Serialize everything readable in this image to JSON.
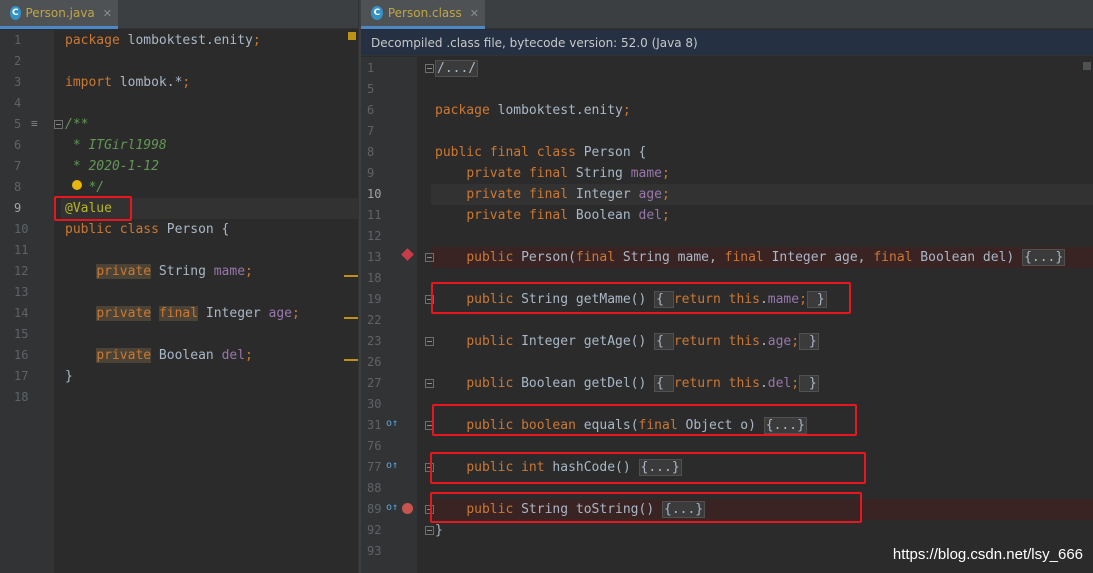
{
  "left": {
    "tab_label": "Person.java",
    "tab_icon": "C",
    "lines": [
      {
        "n": "1",
        "parts": [
          {
            "t": "package",
            "c": "kw"
          },
          {
            "t": " lomboktest.enity",
            "c": ""
          },
          {
            "t": ";",
            "c": "kw"
          }
        ]
      },
      {
        "n": "2",
        "parts": []
      },
      {
        "n": "3",
        "parts": [
          {
            "t": "import",
            "c": "kw"
          },
          {
            "t": " lombok.*",
            "c": ""
          },
          {
            "t": ";",
            "c": "kw"
          }
        ]
      },
      {
        "n": "4",
        "parts": []
      },
      {
        "n": "5",
        "parts": [
          {
            "t": "/**",
            "c": "cmt"
          }
        ]
      },
      {
        "n": "6",
        "parts": [
          {
            "t": " * ITGirl1998",
            "c": "cmt"
          }
        ]
      },
      {
        "n": "7",
        "parts": [
          {
            "t": " * 2020-1-12",
            "c": "cmt"
          }
        ]
      },
      {
        "n": "8",
        "parts": [
          {
            "t": "   */",
            "c": "cmt"
          }
        ]
      },
      {
        "n": "9",
        "parts": [
          {
            "t": "@Value",
            "c": "ann"
          }
        ]
      },
      {
        "n": "10",
        "parts": [
          {
            "t": "public",
            "c": "kw"
          },
          {
            "t": " ",
            "c": ""
          },
          {
            "t": "class",
            "c": "kw"
          },
          {
            "t": " Person {",
            "c": ""
          }
        ]
      },
      {
        "n": "11",
        "parts": []
      },
      {
        "n": "12",
        "parts": [
          {
            "t": "    ",
            "c": ""
          },
          {
            "t": "private",
            "c": "kw hlword"
          },
          {
            "t": " String ",
            "c": ""
          },
          {
            "t": "mame",
            "c": "fld"
          },
          {
            "t": ";",
            "c": "kw"
          }
        ]
      },
      {
        "n": "13",
        "parts": []
      },
      {
        "n": "14",
        "parts": [
          {
            "t": "    ",
            "c": ""
          },
          {
            "t": "private",
            "c": "kw hlword"
          },
          {
            "t": " ",
            "c": ""
          },
          {
            "t": "final",
            "c": "kw hlword"
          },
          {
            "t": " Integer ",
            "c": ""
          },
          {
            "t": "age",
            "c": "fld"
          },
          {
            "t": ";",
            "c": "kw"
          }
        ]
      },
      {
        "n": "15",
        "parts": []
      },
      {
        "n": "16",
        "parts": [
          {
            "t": "    ",
            "c": ""
          },
          {
            "t": "private",
            "c": "kw hlword"
          },
          {
            "t": " Boolean ",
            "c": ""
          },
          {
            "t": "del",
            "c": "fld"
          },
          {
            "t": ";",
            "c": "kw"
          }
        ]
      },
      {
        "n": "17",
        "parts": [
          {
            "t": "}",
            "c": ""
          }
        ]
      },
      {
        "n": "18",
        "parts": []
      }
    ]
  },
  "right": {
    "tab_label": "Person.class",
    "tab_icon": "C",
    "banner": "Decompiled .class file, bytecode version: 52.0 (Java 8)",
    "lines": [
      {
        "n": "1",
        "parts": [
          {
            "t": "/.../",
            "c": "fold"
          }
        ]
      },
      {
        "n": "5",
        "parts": []
      },
      {
        "n": "6",
        "parts": [
          {
            "t": "package",
            "c": "kw"
          },
          {
            "t": " lomboktest.enity",
            "c": ""
          },
          {
            "t": ";",
            "c": "kw"
          }
        ]
      },
      {
        "n": "7",
        "parts": []
      },
      {
        "n": "8",
        "parts": [
          {
            "t": "public",
            "c": "kw"
          },
          {
            "t": " ",
            "c": ""
          },
          {
            "t": "final",
            "c": "kw"
          },
          {
            "t": " ",
            "c": ""
          },
          {
            "t": "class",
            "c": "kw"
          },
          {
            "t": " Person {",
            "c": ""
          }
        ]
      },
      {
        "n": "9",
        "parts": [
          {
            "t": "    ",
            "c": ""
          },
          {
            "t": "private",
            "c": "kw"
          },
          {
            "t": " ",
            "c": ""
          },
          {
            "t": "final",
            "c": "kw"
          },
          {
            "t": " String ",
            "c": ""
          },
          {
            "t": "mame",
            "c": "fld"
          },
          {
            "t": ";",
            "c": "kw"
          }
        ]
      },
      {
        "n": "10",
        "parts": [
          {
            "t": "    ",
            "c": ""
          },
          {
            "t": "private",
            "c": "kw"
          },
          {
            "t": " ",
            "c": ""
          },
          {
            "t": "final",
            "c": "kw"
          },
          {
            "t": " Integer ",
            "c": ""
          },
          {
            "t": "age",
            "c": "fld"
          },
          {
            "t": ";",
            "c": "kw"
          }
        ]
      },
      {
        "n": "11",
        "parts": [
          {
            "t": "    ",
            "c": ""
          },
          {
            "t": "private",
            "c": "kw"
          },
          {
            "t": " ",
            "c": ""
          },
          {
            "t": "final",
            "c": "kw"
          },
          {
            "t": " Boolean ",
            "c": ""
          },
          {
            "t": "del",
            "c": "fld"
          },
          {
            "t": ";",
            "c": "kw"
          }
        ]
      },
      {
        "n": "12",
        "parts": []
      },
      {
        "n": "13",
        "parts": [
          {
            "t": "    ",
            "c": ""
          },
          {
            "t": "public",
            "c": "kw"
          },
          {
            "t": " Person(",
            "c": ""
          },
          {
            "t": "final",
            "c": "kw"
          },
          {
            "t": " String mame, ",
            "c": ""
          },
          {
            "t": "final",
            "c": "kw"
          },
          {
            "t": " Integer age, ",
            "c": ""
          },
          {
            "t": "final",
            "c": "kw"
          },
          {
            "t": " Boolean del) ",
            "c": ""
          },
          {
            "t": "{...}",
            "c": "fold"
          }
        ]
      },
      {
        "n": "18",
        "parts": []
      },
      {
        "n": "19",
        "parts": [
          {
            "t": "    ",
            "c": ""
          },
          {
            "t": "public",
            "c": "kw"
          },
          {
            "t": " String getMame() ",
            "c": ""
          },
          {
            "t": "{ ",
            "c": "fold"
          },
          {
            "t": "return",
            "c": "kw"
          },
          {
            "t": " ",
            "c": ""
          },
          {
            "t": "this",
            "c": "kw"
          },
          {
            "t": ".",
            "c": ""
          },
          {
            "t": "mame",
            "c": "fld"
          },
          {
            "t": ";",
            "c": "kw"
          },
          {
            "t": " }",
            "c": "fold"
          }
        ]
      },
      {
        "n": "22",
        "parts": []
      },
      {
        "n": "23",
        "parts": [
          {
            "t": "    ",
            "c": ""
          },
          {
            "t": "public",
            "c": "kw"
          },
          {
            "t": " Integer getAge() ",
            "c": ""
          },
          {
            "t": "{ ",
            "c": "fold"
          },
          {
            "t": "return",
            "c": "kw"
          },
          {
            "t": " ",
            "c": ""
          },
          {
            "t": "this",
            "c": "kw"
          },
          {
            "t": ".",
            "c": ""
          },
          {
            "t": "age",
            "c": "fld"
          },
          {
            "t": ";",
            "c": "kw"
          },
          {
            "t": " }",
            "c": "fold"
          }
        ]
      },
      {
        "n": "26",
        "parts": []
      },
      {
        "n": "27",
        "parts": [
          {
            "t": "    ",
            "c": ""
          },
          {
            "t": "public",
            "c": "kw"
          },
          {
            "t": " Boolean getDel() ",
            "c": ""
          },
          {
            "t": "{ ",
            "c": "fold"
          },
          {
            "t": "return",
            "c": "kw"
          },
          {
            "t": " ",
            "c": ""
          },
          {
            "t": "this",
            "c": "kw"
          },
          {
            "t": ".",
            "c": ""
          },
          {
            "t": "del",
            "c": "fld"
          },
          {
            "t": ";",
            "c": "kw"
          },
          {
            "t": " }",
            "c": "fold"
          }
        ]
      },
      {
        "n": "30",
        "parts": []
      },
      {
        "n": "31",
        "parts": [
          {
            "t": "    ",
            "c": ""
          },
          {
            "t": "public",
            "c": "kw"
          },
          {
            "t": " ",
            "c": ""
          },
          {
            "t": "boolean",
            "c": "kw"
          },
          {
            "t": " equals(",
            "c": ""
          },
          {
            "t": "final",
            "c": "kw"
          },
          {
            "t": " Object o) ",
            "c": ""
          },
          {
            "t": "{...}",
            "c": "fold"
          }
        ]
      },
      {
        "n": "76",
        "parts": []
      },
      {
        "n": "77",
        "parts": [
          {
            "t": "    ",
            "c": ""
          },
          {
            "t": "public",
            "c": "kw"
          },
          {
            "t": " ",
            "c": ""
          },
          {
            "t": "int",
            "c": "kw"
          },
          {
            "t": " hashCode() ",
            "c": ""
          },
          {
            "t": "{...}",
            "c": "fold"
          }
        ]
      },
      {
        "n": "88",
        "parts": []
      },
      {
        "n": "89",
        "parts": [
          {
            "t": "    ",
            "c": ""
          },
          {
            "t": "public",
            "c": "kw"
          },
          {
            "t": " String toString() ",
            "c": ""
          },
          {
            "t": "{...}",
            "c": "fold"
          }
        ]
      },
      {
        "n": "92",
        "parts": [
          {
            "t": "}",
            "c": ""
          }
        ]
      },
      {
        "n": "93",
        "parts": []
      }
    ]
  },
  "watermark": "https://blog.csdn.net/lsy_666",
  "colors": {
    "keyword": "#cc7832",
    "comment": "#629755",
    "annotation": "#bbb529",
    "field": "#9876aa",
    "highlight_box": "#e8161e"
  }
}
